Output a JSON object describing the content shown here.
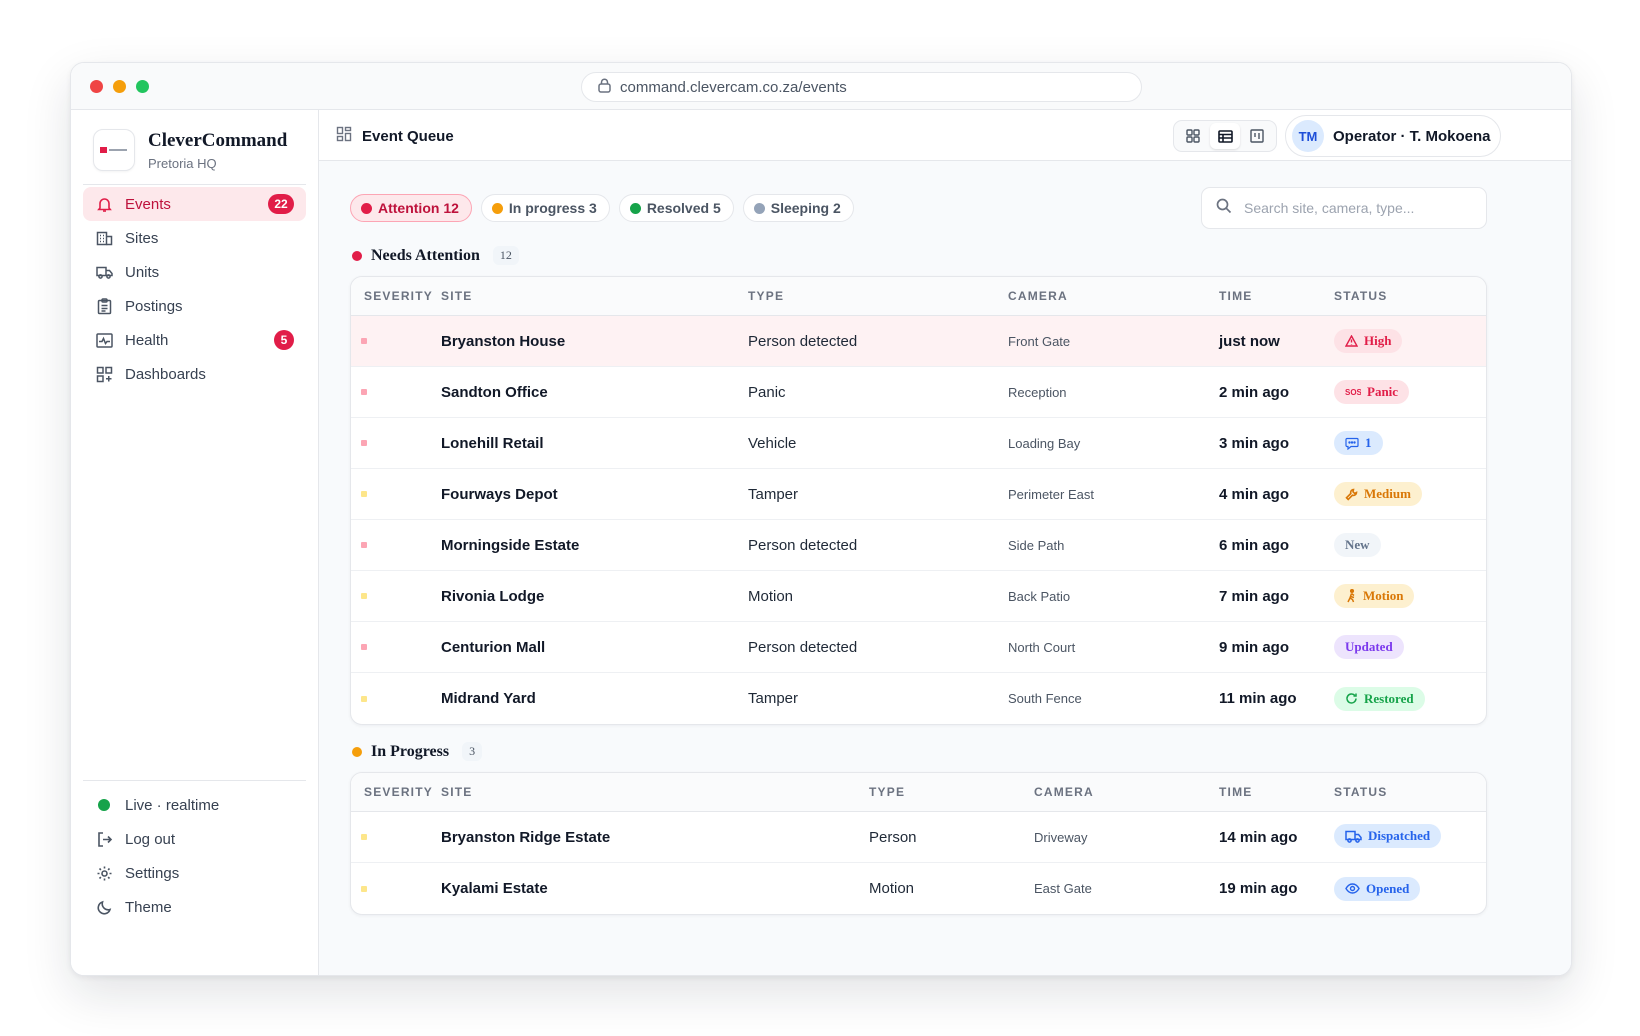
{
  "browser": {
    "url": "command.clevercam.co.za/events"
  },
  "brand": {
    "name": "CleverCommand",
    "location": "Pretoria HQ"
  },
  "nav": [
    {
      "label": "Events",
      "icon": "bell-icon",
      "badge": "22",
      "active": true
    },
    {
      "label": "Sites",
      "icon": "building-icon",
      "badge": null
    },
    {
      "label": "Units",
      "icon": "truck-icon",
      "badge": null
    },
    {
      "label": "Postings",
      "icon": "clipboard-icon",
      "badge": null
    },
    {
      "label": "Health",
      "icon": "pulse-icon",
      "badge": "5"
    },
    {
      "label": "Dashboards",
      "icon": "dashboard-icon",
      "badge": null
    }
  ],
  "bottom_nav": {
    "live": "Live · realtime",
    "logout": "Log out",
    "settings": "Settings",
    "theme": "Theme"
  },
  "topbar": {
    "title": "Event Queue",
    "operator_initials": "TM",
    "operator": "Operator · T. Mokoena"
  },
  "filters": [
    {
      "label": "Attention 12",
      "color": "#e11d48",
      "active": true
    },
    {
      "label": "In progress 3",
      "color": "#f59e0b",
      "active": false
    },
    {
      "label": "Resolved 5",
      "color": "#16a34a",
      "active": false
    },
    {
      "label": "Sleeping 2",
      "color": "#94a3b8",
      "active": false
    }
  ],
  "search": {
    "placeholder": "Search site, camera, type..."
  },
  "columns": [
    "SEVERITY",
    "SITE",
    "TYPE",
    "CAMERA",
    "TIME",
    "STATUS"
  ],
  "attention": {
    "title": "Needs Attention",
    "count": "12",
    "color": "#e11d48",
    "rows": [
      {
        "sev": "#fca5b4",
        "site": "Bryanston House",
        "type": "Person detected",
        "camera": "Front Gate",
        "time": "just now",
        "status": "High",
        "status_icon": "warning-icon",
        "tone": "red",
        "highlight": true
      },
      {
        "sev": "#fca5b4",
        "site": "Sandton Office",
        "type": "Panic",
        "camera": "Reception",
        "time": "2 min ago",
        "status": "Panic",
        "status_icon": "sos-icon",
        "tone": "red"
      },
      {
        "sev": "#fca5b4",
        "site": "Lonehill Retail",
        "type": "Vehicle",
        "camera": "Loading Bay",
        "time": "3 min ago",
        "status": "1",
        "status_icon": "comment-icon",
        "tone": "blue"
      },
      {
        "sev": "#fde68a",
        "site": "Fourways Depot",
        "type": "Tamper",
        "camera": "Perimeter East",
        "time": "4 min ago",
        "status": "Medium",
        "status_icon": "wrench-icon",
        "tone": "amber"
      },
      {
        "sev": "#fca5b4",
        "site": "Morningside Estate",
        "type": "Person detected",
        "camera": "Side Path",
        "time": "6 min ago",
        "status": "New",
        "status_icon": "",
        "tone": "gray"
      },
      {
        "sev": "#fde68a",
        "site": "Rivonia Lodge",
        "type": "Motion",
        "camera": "Back Patio",
        "time": "7 min ago",
        "status": "Motion",
        "status_icon": "walking-icon",
        "tone": "amber"
      },
      {
        "sev": "#fca5b4",
        "site": "Centurion Mall",
        "type": "Person detected",
        "camera": "North Court",
        "time": "9 min ago",
        "status": "Updated",
        "status_icon": "",
        "tone": "purple"
      },
      {
        "sev": "#fde68a",
        "site": "Midrand Yard",
        "type": "Tamper",
        "camera": "South Fence",
        "time": "11 min ago",
        "status": "Restored",
        "status_icon": "refresh-icon",
        "tone": "green"
      }
    ]
  },
  "in_progress": {
    "title": "In Progress",
    "count": "3",
    "color": "#f59e0b",
    "rows": [
      {
        "sev": "#fde68a",
        "site": "Bryanston Ridge Estate",
        "type": "Person",
        "camera": "Driveway",
        "time": "14 min ago",
        "status": "Dispatched",
        "status_icon": "truck-icon",
        "tone": "blue"
      },
      {
        "sev": "#fde68a",
        "site": "Kyalami Estate",
        "type": "Motion",
        "camera": "East Gate",
        "time": "19 min ago",
        "status": "Opened",
        "status_icon": "eye-icon",
        "tone": "blue"
      }
    ]
  }
}
